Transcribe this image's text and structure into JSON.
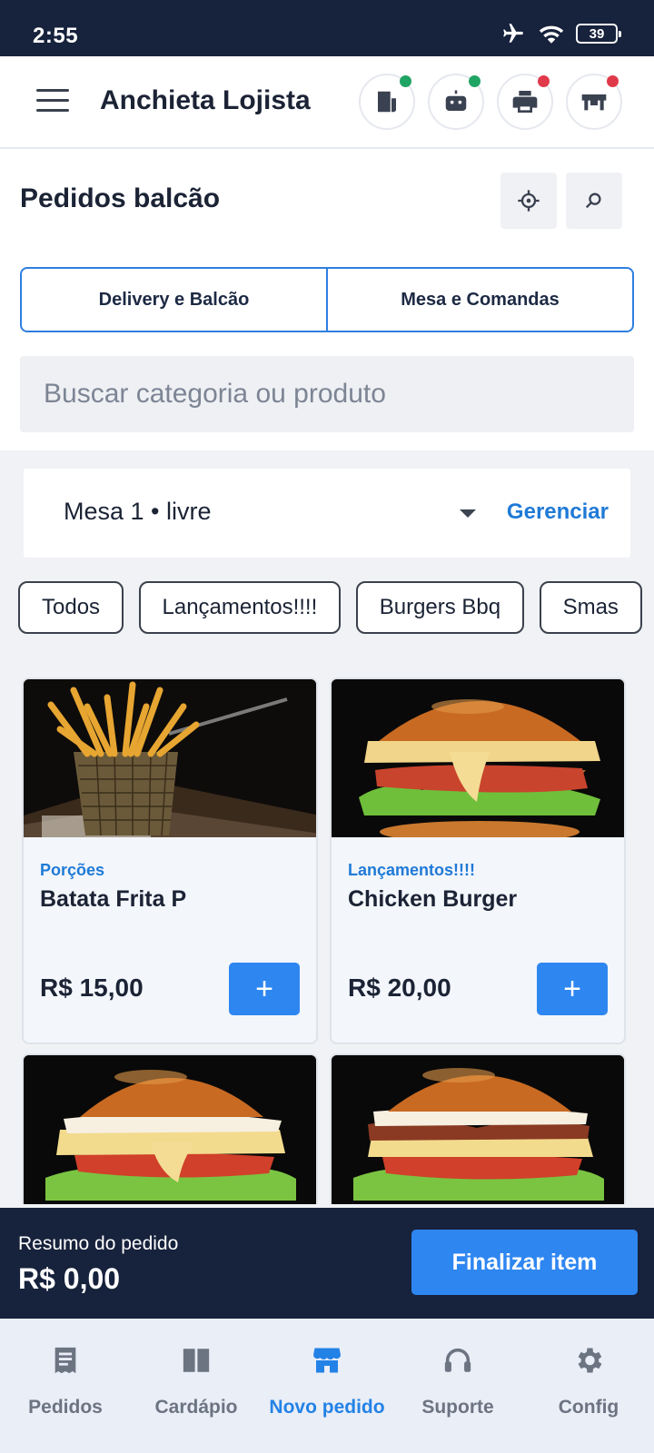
{
  "status_bar": {
    "time": "2:55",
    "battery": "39"
  },
  "header": {
    "title": "Anchieta Lojista",
    "status_icons": [
      {
        "icon": "receipt-icon",
        "dot_color": "#1fa463"
      },
      {
        "icon": "robot-icon",
        "dot_color": "#1fa463"
      },
      {
        "icon": "printer-icon",
        "dot_color": "#e03a4a"
      },
      {
        "icon": "store-icon",
        "dot_color": "#e03a4a"
      }
    ]
  },
  "page": {
    "title": "Pedidos balcão",
    "segments": [
      "Delivery e Balcão",
      "Mesa e Comandas"
    ],
    "search_placeholder": "Buscar categoria ou produto"
  },
  "table_selector": {
    "selected": "Mesa 1 • livre",
    "manage_label": "Gerenciar"
  },
  "categories": [
    "Todos",
    "Lançamentos!!!!",
    "Burgers Bbq",
    "Smas"
  ],
  "products": [
    {
      "category": "Porções",
      "name": "Batata Frita P",
      "price": "R$ 15,00",
      "add_label": "+"
    },
    {
      "category": "Lançamentos!!!!",
      "name": "Chicken Burger",
      "price": "R$ 20,00",
      "add_label": "+"
    },
    {
      "category": "",
      "name": "",
      "price": "",
      "add_label": "+"
    },
    {
      "category": "",
      "name": "",
      "price": "",
      "add_label": "+"
    }
  ],
  "summary": {
    "label": "Resumo do pedido",
    "total": "R$ 0,00",
    "finish_label": "Finalizar item"
  },
  "bottom_nav": [
    {
      "label": "Pedidos",
      "icon": "receipt-icon"
    },
    {
      "label": "Cardápio",
      "icon": "book-icon"
    },
    {
      "label": "Novo pedido",
      "icon": "storefront-icon",
      "active": true
    },
    {
      "label": "Suporte",
      "icon": "headset-icon"
    },
    {
      "label": "Config",
      "icon": "gear-icon"
    }
  ],
  "colors": {
    "primary": "#2e86f1",
    "dark": "#17223c",
    "accent_text": "#1f7ad6"
  }
}
